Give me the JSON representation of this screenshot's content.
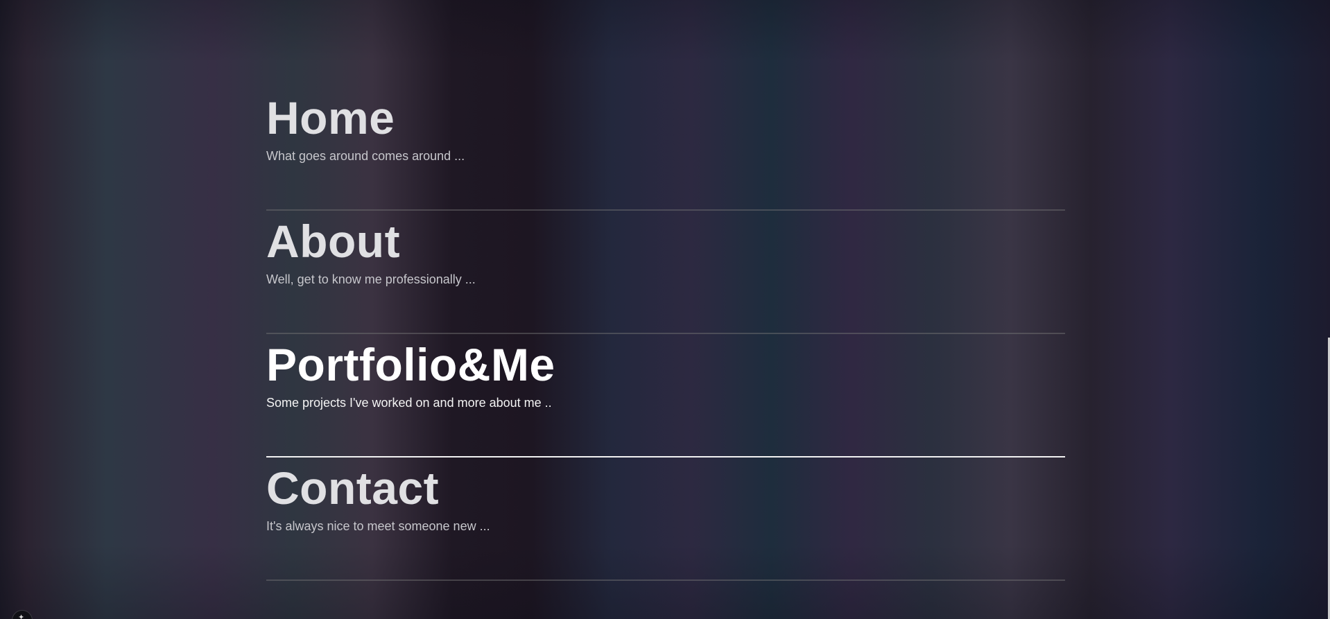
{
  "menu": {
    "items": [
      {
        "title": "Home",
        "subtitle": "What goes around comes around ..."
      },
      {
        "title": "About",
        "subtitle": "Well, get to know me professionally ..."
      },
      {
        "title": "Portfolio&Me",
        "subtitle": "Some projects I've worked on and more about me .."
      },
      {
        "title": "Contact",
        "subtitle": "It's always nice to meet someone new ..."
      }
    ],
    "active_index": 2
  },
  "icons": {
    "corner_badge": "sparkle-icon"
  },
  "colors": {
    "text": "#e0e0e3",
    "active_text": "#ffffff",
    "divider": "#6e6e6e",
    "active_divider": "#f2f2f2"
  }
}
